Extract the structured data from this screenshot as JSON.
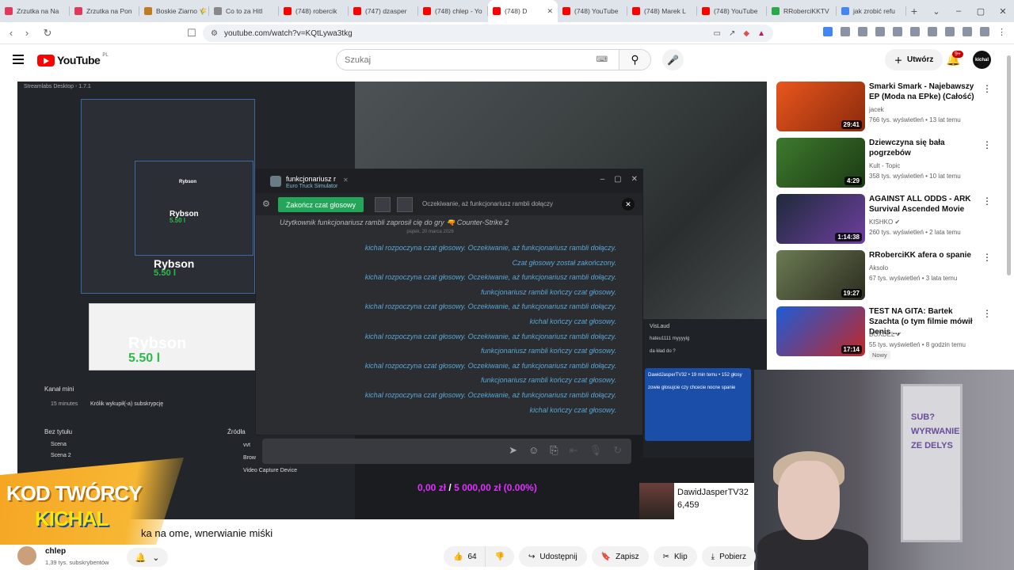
{
  "browser": {
    "tabs": [
      {
        "label": "Zrzutka na Na",
        "color": "#e03a5a"
      },
      {
        "label": "Zrzutka na Pon",
        "color": "#e03a5a"
      },
      {
        "label": "Boskie Ziarno 🌾",
        "color": "#c07a20"
      },
      {
        "label": "Co to za Hitl",
        "color": "#888888"
      },
      {
        "label": "(748) robercik",
        "color": "#ff0000"
      },
      {
        "label": "(747) dzasper",
        "color": "#ff0000"
      },
      {
        "label": "(748) chlep - Yo",
        "color": "#ff0000"
      },
      {
        "label": "(748) D",
        "color": "#ff0000",
        "active": true
      },
      {
        "label": "(748) YouTube",
        "color": "#ff0000"
      },
      {
        "label": "(748) Marek L",
        "color": "#ff0000"
      },
      {
        "label": "(748) YouTube",
        "color": "#ff0000"
      },
      {
        "label": "RRoberciKKTV",
        "color": "#2aa94a"
      },
      {
        "label": "jak zrobić refu",
        "color": "#4285f4"
      }
    ],
    "url": "youtube.com/watch?v=KQtLywa3tkg"
  },
  "youtube": {
    "logo_text": "YouTube",
    "country_code": "PL",
    "search_placeholder": "Szukaj",
    "create_label": "Utwórz",
    "notif_badge": "9+",
    "avatar_text": "kichal"
  },
  "player": {
    "obs_window_title": "Streamlabs Desktop - 1.7.1",
    "rybson_labels": [
      "Rybson",
      "Rybson",
      "Rybson",
      "Rybson"
    ],
    "rybson_values": [
      "5.50 l",
      "5.50 l",
      "5.50 l"
    ],
    "obs_panels": {
      "channel_mini": "Kanał mini",
      "channel_mini_item_time": "15 minutes",
      "channel_mini_item_text": "Królik wykupił(-a) subskrypcję",
      "untitled": "Bez tytułu",
      "sources": "Źródła",
      "scene": "Scena",
      "scene2": "Scena 2",
      "video_capture": "Video Capture Device",
      "brow": "Brow",
      "vvt": "vvt"
    },
    "discord": {
      "user": "funkcjonariusz r",
      "game": "Euro Truck Simulator",
      "end_call_label": "Zakończ czat głosowy",
      "waiting_text": "Oczekiwanie, aż funkcjonariusz rambli dołączy",
      "invite_text": "Użytkownik funkcjonariusz rambli zaprosił cię do gry 🔫 Counter-Strike 2",
      "date_divider": "piątek, 20 marca 2026",
      "messages": [
        "kichal rozpoczyna czat głosowy. Oczekiwanie, aż funkcjonariusz rambli dołączy.",
        "Czat głosowy został zakończony.",
        "kichal rozpoczyna czat głosowy. Oczekiwanie, aż funkcjonariusz rambli dołączy.",
        "funkcjonariusz rambli kończy czat głosowy.",
        "kichal rozpoczyna czat głosowy. Oczekiwanie, aż funkcjonariusz rambli dołączy.",
        "kichal kończy czat głosowy.",
        "kichal rozpoczyna czat głosowy. Oczekiwanie, aż funkcjonariusz rambli dołączy.",
        "funkcjonariusz rambli kończy czat głosowy.",
        "kichal rozpoczyna czat głosowy. Oczekiwanie, aż funkcjonariusz rambli dołączy.",
        "funkcjonariusz rambli kończy czat głosowy.",
        "kichal rozpoczyna czat głosowy. Oczekiwanie, aż funkcjonariusz rambli dołączy.",
        "kichal kończy czat głosowy."
      ]
    },
    "chat_overlay": {
      "line1": "VisLaud",
      "line2": "hateu1111 myyyyig",
      "line3": "da kład do ?",
      "stream_tag": "DawidJasperTV32 • 19 min temu • 152 głosy",
      "poll_text": "zowie głosujcie czy chcecie nocne spanie"
    },
    "donation": {
      "current": "0,00 zł",
      "separator": "/",
      "goal": "5 000,00 zł",
      "percent": "(0.00%)"
    },
    "stream_card": {
      "name": "DawidJasperTV32",
      "count": "6,459"
    },
    "creator_code": {
      "line1": "KOD TWÓRCY",
      "line2": "KICHAL"
    },
    "whiteboard_text": "SUB? WYRWANIE ZE DELYS"
  },
  "video": {
    "title": "ka na ome, wnerwianie miśki",
    "channel": "chlep",
    "subscribers": "1,39 tys. subskrybentów",
    "likes": "64",
    "share_label": "Udostępnij",
    "save_label": "Zapisz",
    "clip_label": "Klip",
    "download_label": "Pobierz"
  },
  "recommendations": [
    {
      "title": "Smarki Smark - Najebawszy EP (Moda na EPke) (Całość)",
      "channel": "jacek",
      "meta": "766 tys. wyświetleń • 13 lat temu",
      "duration": "29:41",
      "verified": false
    },
    {
      "title": "Dziewczyna się bała pogrzebów",
      "channel": "Kult - Topic",
      "meta": "358 tys. wyświetleń • 10 lat temu",
      "duration": "4:29",
      "verified": false
    },
    {
      "title": "AGAINST ALL ODDS - ARK Survival Ascended Movie",
      "channel": "KISHKO",
      "meta": "260 tys. wyświetleń • 2 lata temu",
      "duration": "1:14:38",
      "verified": true
    },
    {
      "title": "RRoberciKK afera o spanie",
      "channel": "Aksolo",
      "meta": "67 tys. wyświetleń • 3 lata temu",
      "duration": "19:27",
      "verified": false
    },
    {
      "title": "TEST NA GITA: Bartek Szachta (o tym filmie mówił Denis ...",
      "channel": "BOXDEL",
      "meta": "55 tys. wyświetleń • 8 godzin temu",
      "duration": "17:14",
      "verified": true,
      "badge": "Nowy"
    }
  ]
}
